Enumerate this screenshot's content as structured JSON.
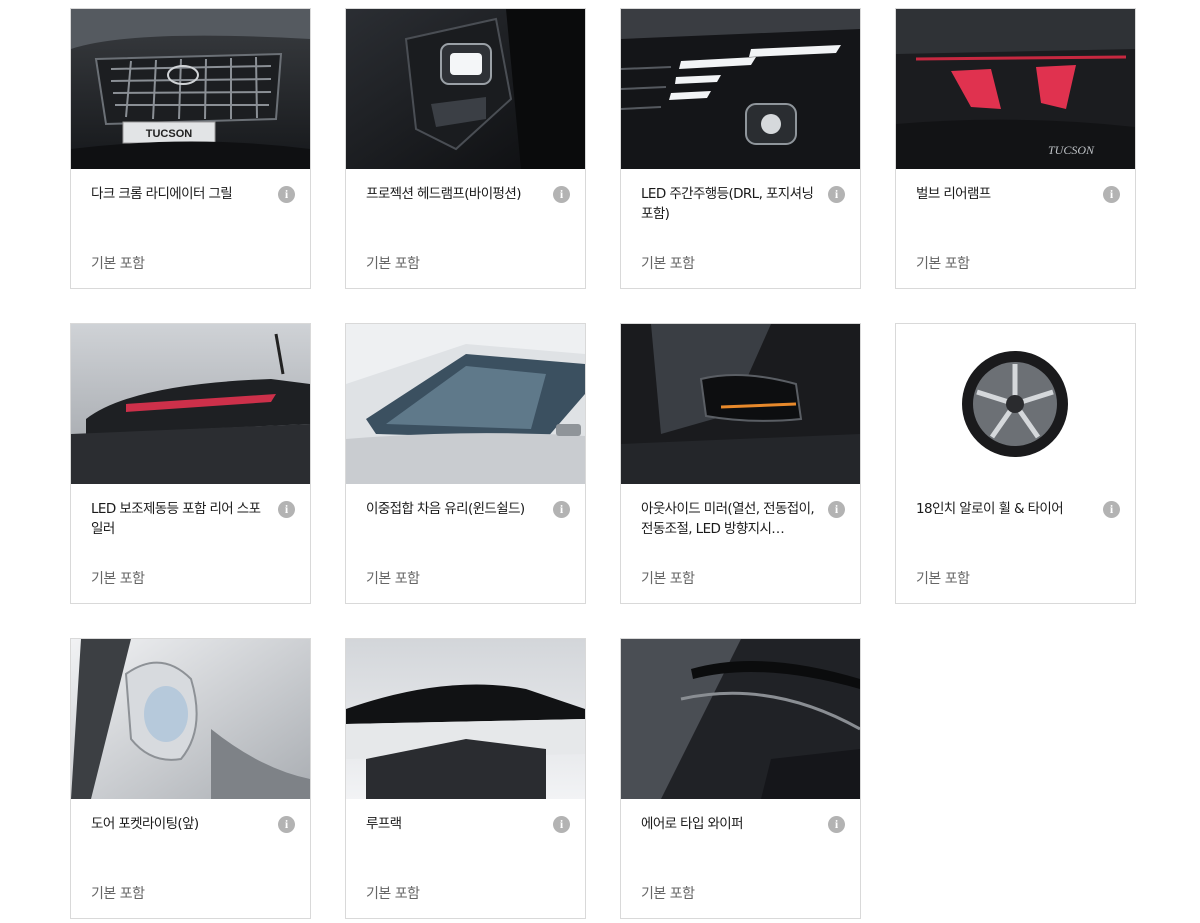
{
  "options": [
    {
      "name": "다크 크롬 라디에이터 그릴",
      "status": "기본 포함",
      "image": "dark-chrome-radiator-grille",
      "badge_text": "TUCSON"
    },
    {
      "name": "프로젝션 헤드램프(바이펑션)",
      "status": "기본 포함",
      "image": "projection-headlamp"
    },
    {
      "name": "LED 주간주행등(DRL, 포지셔닝 포함)",
      "status": "기본 포함",
      "image": "led-drl"
    },
    {
      "name": "벌브 리어램프",
      "status": "기본 포함",
      "image": "bulb-rear-lamp",
      "badge_text": "TUCSON"
    },
    {
      "name": "LED 보조제동등 포함 리어 스포일러",
      "status": "기본 포함",
      "image": "rear-spoiler"
    },
    {
      "name": "이중접합 차음 유리(윈드쉴드)",
      "status": "기본 포함",
      "image": "windshield-glass"
    },
    {
      "name": "아웃사이드 미러(열선, 전동접이, 전동조절, LED 방향지시…",
      "status": "기본 포함",
      "image": "outside-mirror"
    },
    {
      "name": "18인치 알로이 휠 & 타이어",
      "status": "기본 포함",
      "image": "alloy-wheel"
    },
    {
      "name": "도어 포켓라이팅(앞)",
      "status": "기본 포함",
      "image": "door-pocket-lighting"
    },
    {
      "name": "루프랙",
      "status": "기본 포함",
      "image": "roof-rack"
    },
    {
      "name": "에어로 타입 와이퍼",
      "status": "기본 포함",
      "image": "aero-wiper"
    }
  ],
  "info_icon_glyph": "i",
  "colors": {
    "card_border": "#d9d9d9",
    "info_icon_bg": "#b3b3b3",
    "status_text": "#666666",
    "tail_light_red": "#e0324f",
    "mirror_indicator": "#e8892b"
  }
}
